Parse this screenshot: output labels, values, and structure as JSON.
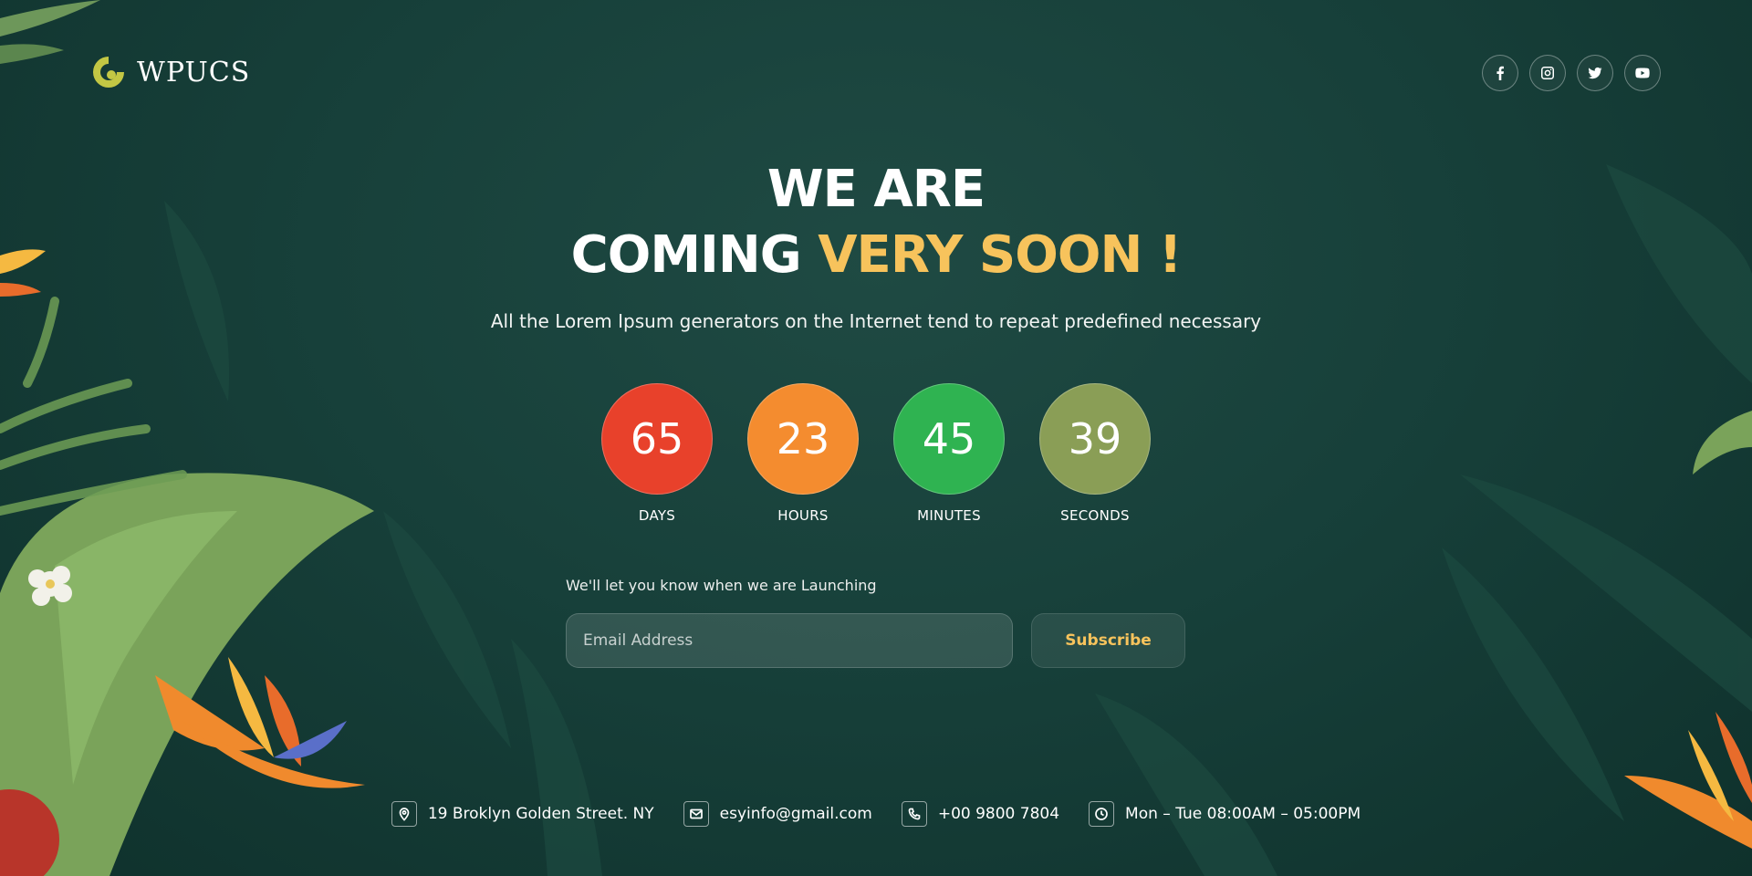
{
  "brand": {
    "name": "WPUCS",
    "logo_color": "#c3c744"
  },
  "social": [
    {
      "name": "facebook-icon"
    },
    {
      "name": "instagram-icon"
    },
    {
      "name": "twitter-icon"
    },
    {
      "name": "youtube-icon"
    }
  ],
  "hero": {
    "title_line1": "WE ARE",
    "title_line2_white": "COMING ",
    "title_line2_accent": "VERY SOON !",
    "subtitle": "All the Lorem Ipsum generators on the Internet tend to repeat predefined necessary"
  },
  "countdown": {
    "days": {
      "value": "65",
      "label": "DAYS",
      "color": "#e8412b"
    },
    "hours": {
      "value": "23",
      "label": "HOURS",
      "color": "#f48c2f"
    },
    "minutes": {
      "value": "45",
      "label": "MINUTES",
      "color": "#2fb351"
    },
    "seconds": {
      "value": "39",
      "label": "SECONDS",
      "color": "#8a9e56"
    }
  },
  "subscribe": {
    "prompt": "We'll let you know when we are Launching",
    "placeholder": "Email Address",
    "value": "",
    "button_label": "Subscribe"
  },
  "contacts": {
    "address": "19 Broklyn Golden Street. NY",
    "email": "esyinfo@gmail.com",
    "phone": "+00 9800 7804",
    "hours": "Mon – Tue 08:00AM – 05:00PM"
  },
  "colors": {
    "accent": "#f7c35c",
    "background": "#17403a"
  }
}
